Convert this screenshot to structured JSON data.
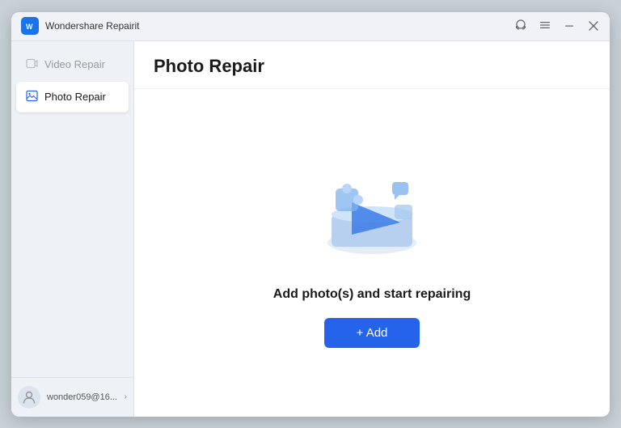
{
  "window": {
    "title": "Wondershare Repairit"
  },
  "titlebar": {
    "app_name": "Wondershare Repairit",
    "controls": {
      "headset_icon": "🎧",
      "menu_icon": "☰",
      "minimize_label": "−",
      "close_label": "✕"
    }
  },
  "sidebar": {
    "items": [
      {
        "id": "video-repair",
        "label": "Video Repair",
        "icon": "🎬",
        "active": false,
        "disabled": true
      },
      {
        "id": "photo-repair",
        "label": "Photo Repair",
        "icon": "🖼",
        "active": true,
        "disabled": false
      }
    ],
    "footer": {
      "username": "wonder059@16...",
      "avatar_icon": "👤"
    }
  },
  "content": {
    "header": {
      "title": "Photo Repair"
    },
    "body": {
      "prompt": "Add photo(s) and start repairing",
      "add_button_label": "+ Add"
    }
  }
}
